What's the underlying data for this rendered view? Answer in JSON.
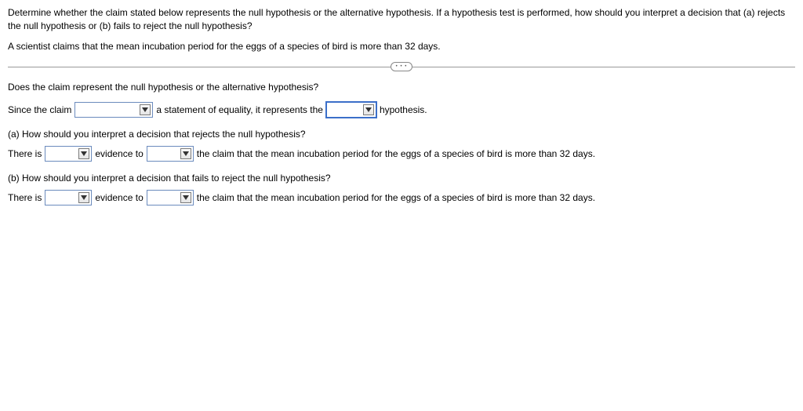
{
  "intro": "Determine whether the claim stated below represents the null hypothesis or the alternative hypothesis. If a hypothesis test is performed, how should you interpret a decision that (a) rejects the null hypothesis or (b) fails to reject the null hypothesis?",
  "claim": "A scientist claims that the mean incubation period for the eggs of a species of bird is more than 32 days.",
  "q1": {
    "prompt": "Does the claim represent the null hypothesis or the alternative hypothesis?",
    "pre": "Since the claim",
    "mid": "a statement of equality, it represents the",
    "post": "hypothesis."
  },
  "a": {
    "label": "(a) How should you interpret a decision that rejects the null hypothesis?",
    "pre": "There is",
    "mid": "evidence to",
    "post": "the claim that the mean incubation period for the eggs of a species of bird is more than 32 days."
  },
  "b": {
    "label": "(b) How should you interpret a decision that fails to reject the null hypothesis?",
    "pre": "There is",
    "mid": "evidence to",
    "post": "the claim that the mean incubation period for the eggs of a species of bird is more than 32 days."
  },
  "pill": "• • •"
}
